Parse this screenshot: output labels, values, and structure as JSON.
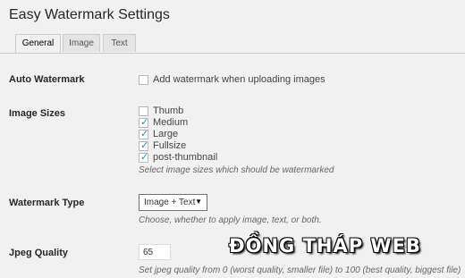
{
  "page": {
    "title": "Easy Watermark Settings"
  },
  "tabs": [
    {
      "label": "General",
      "active": true
    },
    {
      "label": "Image",
      "active": false
    },
    {
      "label": "Text",
      "active": false
    }
  ],
  "auto_watermark": {
    "label": "Auto Watermark",
    "checkbox_label": "Add watermark when uploading images",
    "checked": false
  },
  "image_sizes": {
    "label": "Image Sizes",
    "options": [
      {
        "label": "Thumb",
        "checked": false
      },
      {
        "label": "Medium",
        "checked": true
      },
      {
        "label": "Large",
        "checked": true
      },
      {
        "label": "Fullsize",
        "checked": true
      },
      {
        "label": "post-thumbnail",
        "checked": true
      }
    ],
    "description": "Select image sizes which should be watermarked"
  },
  "watermark_type": {
    "label": "Watermark Type",
    "selected": "Image + Text",
    "caret": "▼",
    "description": "Choose, whether to apply image, text, or both."
  },
  "jpeg_quality": {
    "label": "Jpeg Quality",
    "value": "65",
    "description": "Set jpeg quality from 0 (worst quality, smaller file) to 100 (best quality, biggest file)"
  },
  "overlay": {
    "watermark_text": "ĐỒNG THÁP WEB"
  },
  "colors": {
    "accent": "#1e8cbe",
    "background": "#f1f1f1"
  }
}
